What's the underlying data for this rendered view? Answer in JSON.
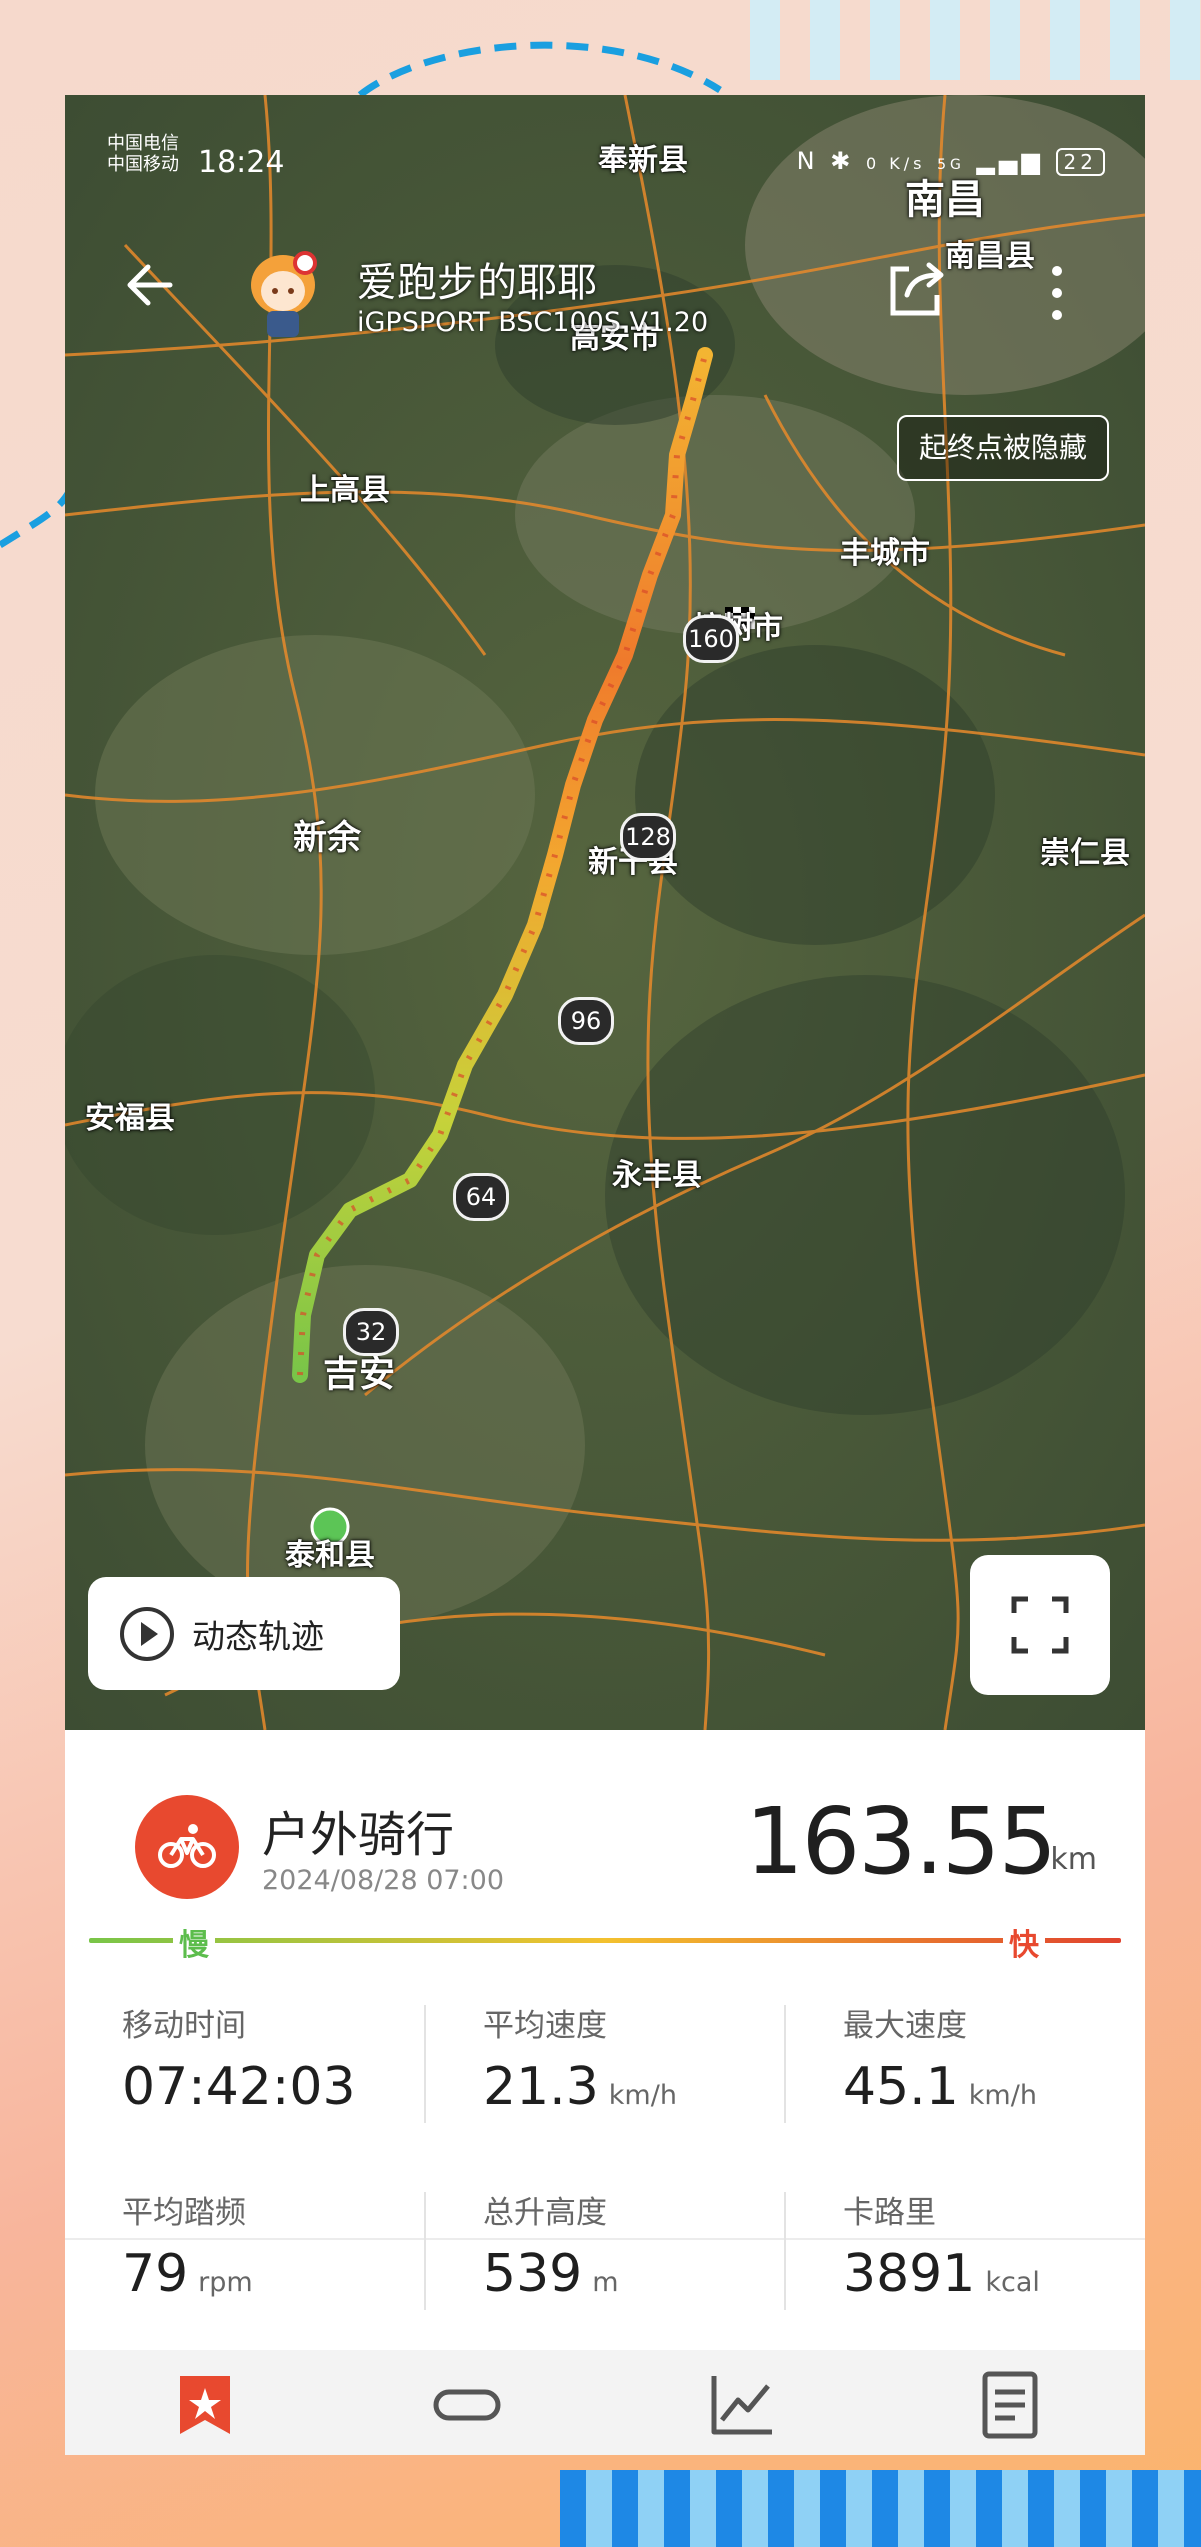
{
  "status_bar": {
    "carrier_1": "中国电信",
    "carrier_2": "中国移动",
    "time": "18:24",
    "net_speed": "0 K/s",
    "signal": "5G",
    "battery": "22"
  },
  "header": {
    "username": "爱跑步的耶耶",
    "device": "iGPSPORT BSC100S V1.20",
    "hidden_badge": "起终点被隐藏"
  },
  "map": {
    "places": [
      "南昌",
      "南昌县",
      "奉新县",
      "高安市",
      "上高县",
      "丰城市",
      "樟树市",
      "新余",
      "新干县",
      "崇仁县",
      "安福县",
      "永丰县",
      "吉安",
      "泰和县"
    ],
    "km_markers": [
      "160",
      "128",
      "96",
      "64",
      "32"
    ],
    "route_colors": {
      "slow": "#79c548",
      "mid": "#f3c12f",
      "fast": "#e0432e"
    },
    "play_label": "动态轨迹"
  },
  "activity": {
    "name": "户外骑行",
    "datetime": "2024/08/28 07:00",
    "distance": "163.55",
    "distance_unit": "km",
    "slow_label": "慢",
    "fast_label": "快",
    "accent": "#e8492f"
  },
  "stats": {
    "moving_time": {
      "label": "移动时间",
      "value": "07:42:03",
      "unit": ""
    },
    "avg_speed": {
      "label": "平均速度",
      "value": "21.3",
      "unit": "km/h"
    },
    "max_speed": {
      "label": "最大速度",
      "value": "45.1",
      "unit": "km/h"
    },
    "avg_cadence": {
      "label": "平均踏频",
      "value": "79",
      "unit": "rpm"
    },
    "total_ascent": {
      "label": "总升高度",
      "value": "539",
      "unit": "m"
    },
    "calories": {
      "label": "卡路里",
      "value": "3891",
      "unit": "kcal"
    }
  },
  "tabs": [
    {
      "icon": "star-bookmark-icon",
      "active": true
    },
    {
      "icon": "lap-track-icon",
      "active": false
    },
    {
      "icon": "chart-icon",
      "active": false
    },
    {
      "icon": "document-icon",
      "active": false
    }
  ]
}
